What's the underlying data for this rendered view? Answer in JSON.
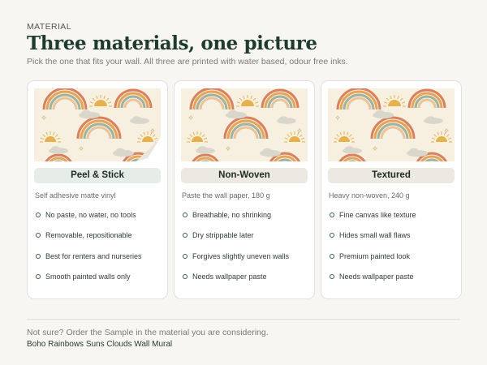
{
  "header": {
    "eyebrow": "MATERIAL",
    "title": "Three materials, one picture",
    "subtitle": "Pick the one that fits your wall. All three are printed with water based, odour free inks."
  },
  "materials": [
    {
      "name": "Peel & Stick",
      "spec": "Self adhesive matte vinyl",
      "features": [
        "No paste, no water, no tools",
        "Removable, repositionable",
        "Best for renters and nurseries",
        "Smooth painted walls only"
      ],
      "pill_color": "#e6ece8",
      "corner": "peeled"
    },
    {
      "name": "Non-Woven",
      "spec": "Paste the wall paper, 180 g",
      "features": [
        "Breathable, no shrinking",
        "Dry strippable later",
        "Forgives slightly uneven walls",
        "Needs wallpaper paste"
      ],
      "pill_color": "#ece9e3",
      "corner": "flat"
    },
    {
      "name": "Textured",
      "spec": "Heavy non-woven, 240 g",
      "features": [
        "Fine canvas like texture",
        "Hides small wall flaws",
        "Premium painted look",
        "Needs wallpaper paste"
      ],
      "pill_color": "#ece9e3",
      "corner": "flat"
    }
  ],
  "footer": {
    "note": "Not sure? Order the Sample in the material you are considering.",
    "product": "Boho Rainbows Suns Clouds Wall Mural"
  },
  "colors": {
    "background": "#f7f6f3",
    "title": "#1f3a2f",
    "bullet": "#3d5c4a",
    "swatch_bg": "#f7efdf",
    "rainbow": [
      "#d9805e",
      "#e6a458",
      "#9fb2a0",
      "#e9c49a"
    ],
    "sun": "#e7b24e",
    "cloud": "#d9d6cc"
  }
}
